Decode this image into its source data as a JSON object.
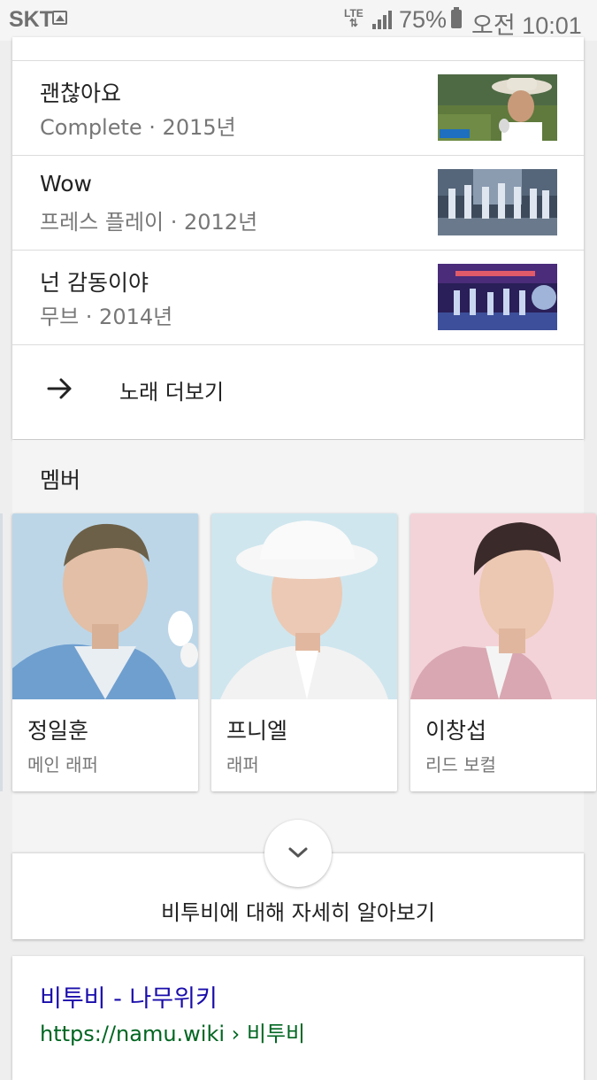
{
  "status_bar": {
    "carrier": "SKT",
    "network": "LTE",
    "battery": "75%",
    "time": "오전 10:01"
  },
  "songs": [
    {
      "title": "괜찮아요",
      "meta": "Complete · 2015년"
    },
    {
      "title": "Wow",
      "meta": "프레스 플레이 · 2012년"
    },
    {
      "title": "넌 감동이야",
      "meta": "무브 · 2014년"
    }
  ],
  "more_songs_label": "노래 더보기",
  "members": {
    "title": "멤버",
    "items": [
      {
        "name": "정일훈",
        "role": "메인 래퍼"
      },
      {
        "name": "프니엘",
        "role": "래퍼"
      },
      {
        "name": "이창섭",
        "role": "리드 보컬"
      }
    ]
  },
  "learn_more_label": "비투비에 대해 자세히 알아보기",
  "result": {
    "title": "비투비 - 나무위키",
    "url": "https://namu.wiki › 비투비"
  }
}
